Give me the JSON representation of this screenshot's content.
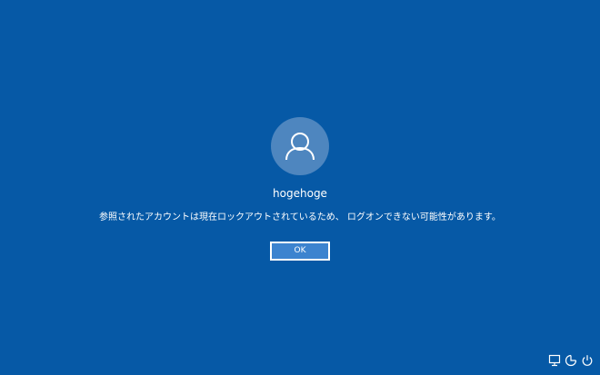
{
  "user": {
    "name": "hogehoge",
    "avatar_icon": "user-silhouette-icon"
  },
  "message": "参照されたアカウントは現在ロックアウトされているため、 ログオンできない可能性があります。",
  "buttons": {
    "ok_label": "OK"
  },
  "tray": {
    "icons": [
      "network-icon",
      "ease-of-access-icon",
      "power-icon"
    ]
  },
  "colors": {
    "background": "#0659a6",
    "avatar": "#4e86bf",
    "button": "#3c83cf",
    "text": "#ffffff"
  }
}
